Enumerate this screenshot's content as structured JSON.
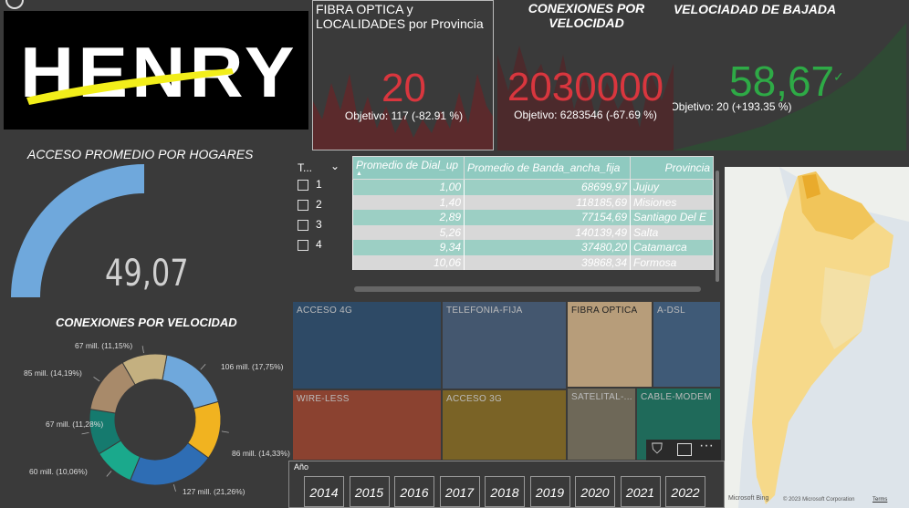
{
  "logo": {
    "text": "HENRY"
  },
  "kpis": [
    {
      "title": "FIBRA OPTICA y LOCALIDADES por Provincia",
      "value": "20",
      "target": "Objetivo: 117 (-82.91 %)",
      "color": "#d9363e"
    },
    {
      "title": "CONEXIONES POR VELOCIDAD",
      "value": "2030000",
      "target": "Objetivo: 6283546 (-67.69 %)",
      "color": "#d9363e"
    },
    {
      "title": "VELOCIADAD DE BAJADA",
      "value": "58,67",
      "target": "Objetivo: 20 (+193.35 %)",
      "color": "#2eaa46"
    }
  ],
  "gauge": {
    "title": "ACCESO PROMEDIO POR HOGARES",
    "value": "49,07",
    "fill_fraction": 0.49,
    "color": "#6fa8dc"
  },
  "slicer": {
    "header": "T...",
    "options": [
      "1",
      "2",
      "3",
      "4"
    ]
  },
  "table": {
    "columns": [
      "Promedio de Dial_up",
      "Promedio de Banda_ancha_fija",
      "Provincia"
    ],
    "rows": [
      [
        "1,00",
        "68699,97",
        "Jujuy"
      ],
      [
        "1,40",
        "118185,69",
        "Misiones"
      ],
      [
        "2,89",
        "77154,69",
        "Santiago Del E"
      ],
      [
        "5,26",
        "140139,49",
        "Salta"
      ],
      [
        "9,34",
        "37480,20",
        "Catamarca"
      ],
      [
        "10,06",
        "39868,34",
        "Formosa"
      ]
    ]
  },
  "treemap": {
    "tiles": [
      {
        "label": "ACCESO 4G",
        "color": "#2e4a66"
      },
      {
        "label": "TELEFONIA-FIJA",
        "color": "#44576f"
      },
      {
        "label": "FIBRA OPTICA",
        "color": "#b79d7a"
      },
      {
        "label": "A-DSL",
        "color": "#3f5a77"
      },
      {
        "label": "WIRE-LESS",
        "color": "#8b4230"
      },
      {
        "label": "ACCESO 3G",
        "color": "#7a6326"
      },
      {
        "label": "SATELITAL-...",
        "color": "#6e6858"
      },
      {
        "label": "CABLE-MODEM",
        "color": "#1f6a5a"
      }
    ]
  },
  "donut": {
    "title": "CONEXIONES POR VELOCIDAD",
    "slices": [
      {
        "label": "106 mill. (17,75%)",
        "value": 17.75,
        "color": "#6fa8dc"
      },
      {
        "label": "86 mill. (14,33%)",
        "value": 14.33,
        "color": "#f1b320"
      },
      {
        "label": "127 mill. (21,26%)",
        "value": 21.26,
        "color": "#2e6db4"
      },
      {
        "label": "60 mill. (10,06%)",
        "value": 10.06,
        "color": "#1aa98c"
      },
      {
        "label": "67 mill. (11,28%)",
        "value": 11.28,
        "color": "#157a6e"
      },
      {
        "label": "85 mill. (14,19%)",
        "value": 14.19,
        "color": "#a88a6a"
      },
      {
        "label": "67 mill. (11,15%)",
        "value": 11.15,
        "color": "#c4b080"
      }
    ]
  },
  "years": {
    "header": "Año",
    "items": [
      "2014",
      "2015",
      "2016",
      "2017",
      "2018",
      "2019",
      "2020",
      "2021",
      "2022"
    ]
  },
  "map": {
    "brand": "Microsoft Bing",
    "copyright": "© 2023 Microsoft Corporation",
    "terms": "Terms"
  },
  "icons": [
    "filter-icon",
    "focus-mode-icon",
    "more-options-icon",
    "info-icon"
  ]
}
